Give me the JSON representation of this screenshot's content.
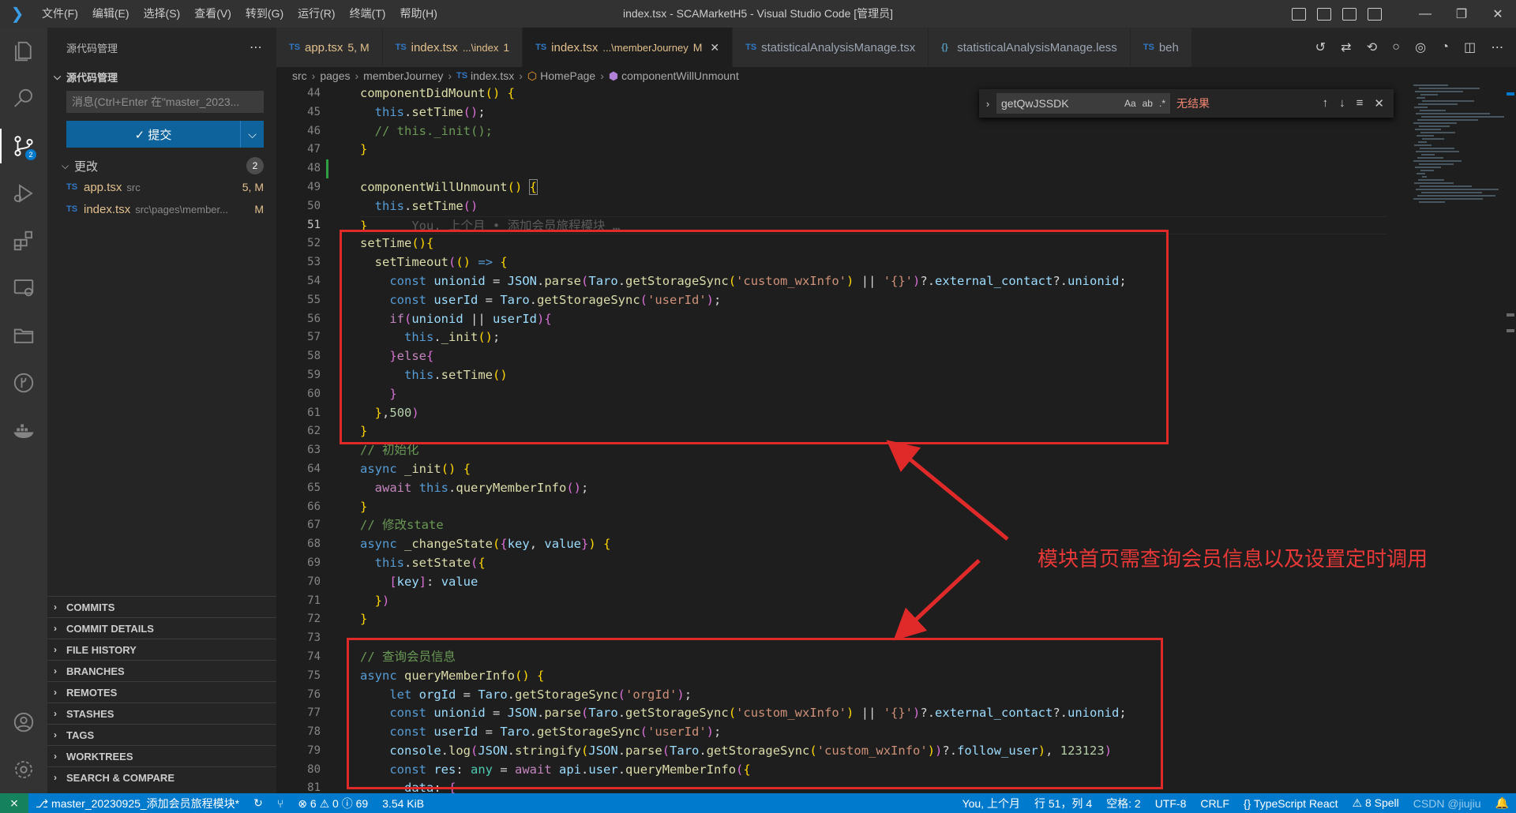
{
  "titlebar": {
    "menus": [
      "文件(F)",
      "编辑(E)",
      "选择(S)",
      "查看(V)",
      "转到(G)",
      "运行(R)",
      "终端(T)",
      "帮助(H)"
    ],
    "title": "index.tsx - SCAMarketH5 - Visual Studio Code [管理员]"
  },
  "sidebar": {
    "header": "源代码管理",
    "section": "源代码管理",
    "commit_placeholder": "消息(Ctrl+Enter 在\"master_2023...",
    "commit_button": "✓ 提交",
    "changes_label": "更改",
    "changes_count": "2",
    "files": [
      {
        "name": "app.tsx",
        "dir": "src",
        "status": "5, M"
      },
      {
        "name": "index.tsx",
        "dir": "src\\pages\\member...",
        "status": "M"
      }
    ],
    "panels": [
      "COMMITS",
      "COMMIT DETAILS",
      "FILE HISTORY",
      "BRANCHES",
      "REMOTES",
      "STASHES",
      "TAGS",
      "WORKTREES",
      "SEARCH & COMPARE"
    ]
  },
  "activity": {
    "scm_badge": "2"
  },
  "tabs": [
    {
      "label": "app.tsx",
      "desc": "",
      "status": "5, M"
    },
    {
      "label": "index.tsx",
      "desc": "...\\index",
      "status": "1"
    },
    {
      "label": "index.tsx",
      "desc": "...\\memberJourney",
      "status": "M"
    },
    {
      "label": "statisticalAnalysisManage.tsx",
      "desc": "",
      "status": ""
    },
    {
      "label": "statisticalAnalysisManage.less",
      "desc": "",
      "status": ""
    },
    {
      "label": "beh",
      "desc": "",
      "status": ""
    }
  ],
  "breadcrumb": [
    "src",
    "pages",
    "memberJourney",
    "index.tsx",
    "HomePage",
    "componentWillUnmount"
  ],
  "find": {
    "query": "getQwJSSDK",
    "result": "无结果"
  },
  "blame": "You, 上个月 • 添加会员旅程模块 …",
  "annotation": "模块首页需查询会员信息以及设置定时调用",
  "statusbar": {
    "branch": "master_20230925_添加会员旅程模块*",
    "problems": "⊗ 6 ⚠ 0 ⓘ 69",
    "size": "3.54 KiB",
    "blame": "You, 上个月",
    "position": "行 51，列 4",
    "spaces": "空格: 2",
    "encoding": "UTF-8",
    "eol": "CRLF",
    "language": "{} TypeScript React",
    "spell": "⚠ 8 Spell",
    "watermark": "CSDN @jiujiu"
  }
}
